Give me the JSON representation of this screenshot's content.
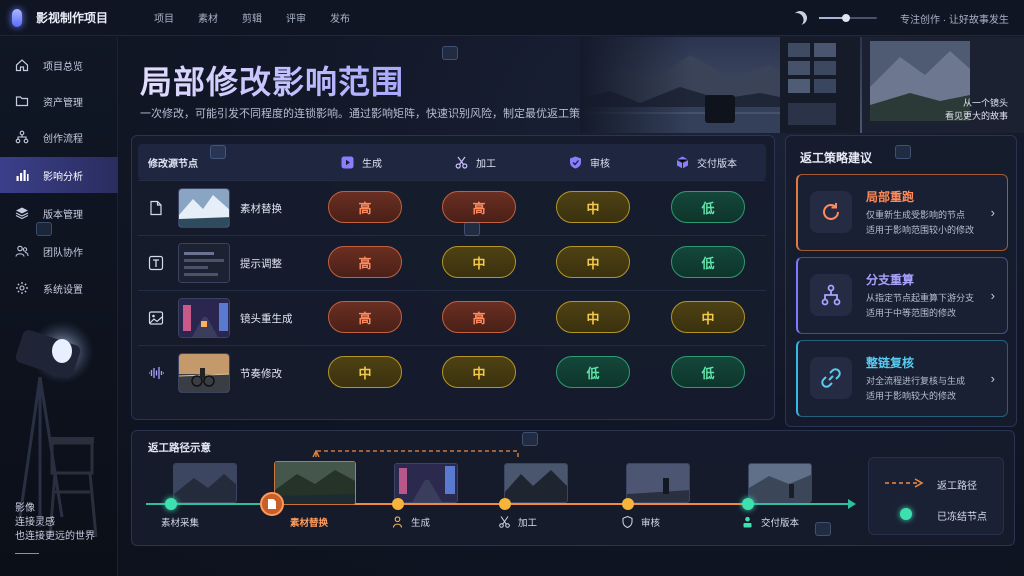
{
  "app": {
    "title": "影视制作项目",
    "tagline": "专注创作 · 让好故事发生"
  },
  "topnav": [
    "项目",
    "素材",
    "剪辑",
    "评审",
    "发布"
  ],
  "theme_slider": {
    "value_percent": 47
  },
  "sidebar": {
    "items": [
      {
        "label": "项目总览",
        "icon": "home-icon"
      },
      {
        "label": "资产管理",
        "icon": "folder-icon"
      },
      {
        "label": "创作流程",
        "icon": "flow-icon"
      },
      {
        "label": "影响分析",
        "icon": "chart-icon",
        "active": true
      },
      {
        "label": "版本管理",
        "icon": "layers-icon"
      },
      {
        "label": "团队协作",
        "icon": "team-icon"
      },
      {
        "label": "系统设置",
        "icon": "gear-icon"
      }
    ],
    "copy": [
      "影像",
      "连接灵感",
      "也连接更远的世界"
    ]
  },
  "hero": {
    "title": "局部修改影响范围",
    "subtitle": "一次修改，可能引发不同程度的连锁影响。通过影响矩阵，快速识别风险，制定最优返工策略。",
    "art_caption": [
      "从一个镜头",
      "看见更大的故事"
    ]
  },
  "matrix": {
    "corner_label": "修改源节点",
    "columns": [
      {
        "label": "生成",
        "icon": "play-icon"
      },
      {
        "label": "加工",
        "icon": "scissors-icon"
      },
      {
        "label": "审核",
        "icon": "shield-icon"
      },
      {
        "label": "交付版本",
        "icon": "cube-icon"
      }
    ],
    "rows": [
      {
        "label": "素材替换",
        "icon": "file-icon",
        "cells": [
          {
            "text": "高",
            "level": "high"
          },
          {
            "text": "高",
            "level": "high"
          },
          {
            "text": "中",
            "level": "mid"
          },
          {
            "text": "低",
            "level": "low"
          }
        ]
      },
      {
        "label": "提示调整",
        "icon": "text-icon",
        "cells": [
          {
            "text": "高",
            "level": "high"
          },
          {
            "text": "中",
            "level": "mid"
          },
          {
            "text": "中",
            "level": "mid"
          },
          {
            "text": "低",
            "level": "low"
          }
        ]
      },
      {
        "label": "镜头重生成",
        "icon": "image-icon",
        "cells": [
          {
            "text": "高",
            "level": "high"
          },
          {
            "text": "高",
            "level": "high"
          },
          {
            "text": "中",
            "level": "mid"
          },
          {
            "text": "中",
            "level": "mid"
          }
        ]
      },
      {
        "label": "节奏修改",
        "icon": "waveform-icon",
        "cells": [
          {
            "text": "中",
            "level": "mid"
          },
          {
            "text": "中",
            "level": "mid"
          },
          {
            "text": "低",
            "level": "low"
          },
          {
            "text": "低",
            "level": "low"
          }
        ]
      }
    ],
    "colors": {
      "high": "#ff8a5e",
      "mid": "#f4c94a",
      "low": "#5fe3a8"
    }
  },
  "strategy": {
    "title": "返工策略建议",
    "cards": [
      {
        "title": "局部重跑",
        "desc1": "仅重新生成受影响的节点",
        "desc2": "适用于影响范围较小的修改",
        "icon": "refresh-icon",
        "color": "#ff8a5a"
      },
      {
        "title": "分支重算",
        "desc1": "从指定节点起重算下游分支",
        "desc2": "适用于中等范围的修改",
        "icon": "branch-icon",
        "color": "#a9a3ff"
      },
      {
        "title": "整链复核",
        "desc1": "对全流程进行复核与生成",
        "desc2": "适用于影响较大的修改",
        "icon": "link-icon",
        "color": "#56ccf2"
      }
    ]
  },
  "path": {
    "title": "返工路径示意",
    "nodes": [
      {
        "label": "素材采集",
        "state": "frozen"
      },
      {
        "label": "素材替换",
        "state": "source"
      },
      {
        "label": "生成",
        "state": "rework",
        "icon": "person-icon"
      },
      {
        "label": "加工",
        "state": "rework",
        "icon": "scissors-icon"
      },
      {
        "label": "审核",
        "state": "rework",
        "icon": "shield-icon"
      },
      {
        "label": "交付版本",
        "state": "frozen",
        "icon": "user-icon"
      }
    ],
    "legend": [
      {
        "label": "返工路径",
        "color": "#f08a3e"
      },
      {
        "label": "已冻结节点",
        "color": "#3fe0b0"
      }
    ]
  }
}
